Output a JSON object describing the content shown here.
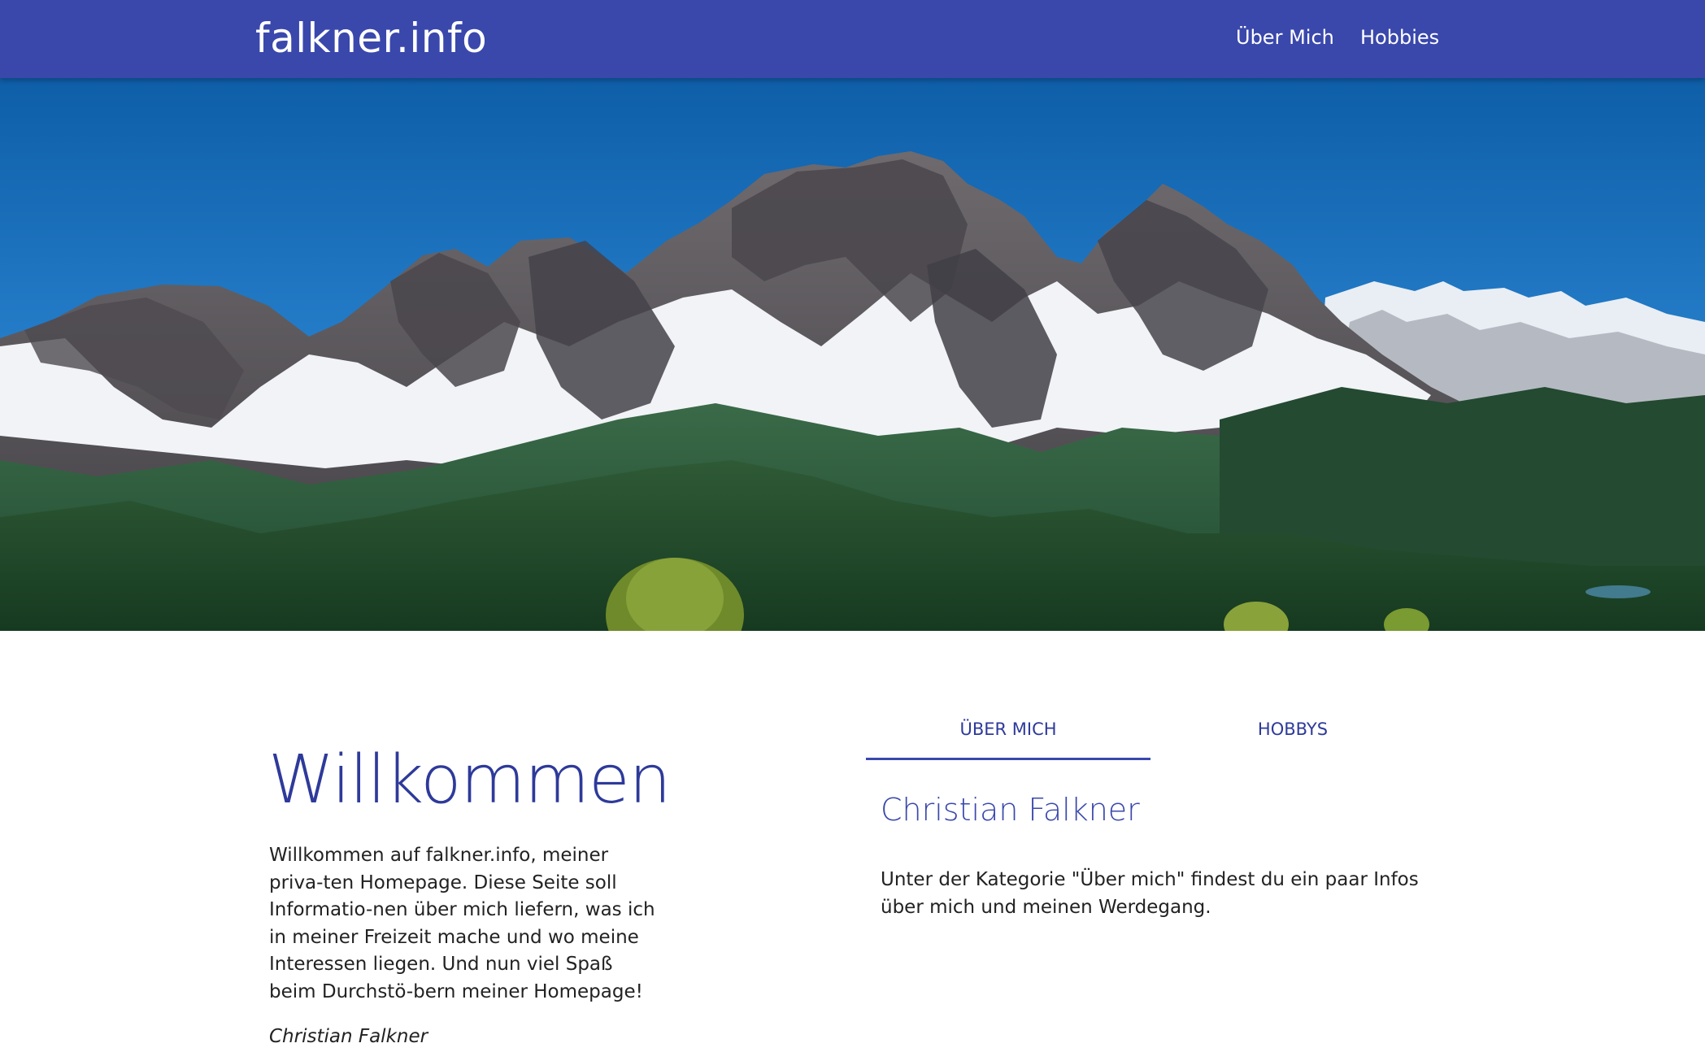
{
  "header": {
    "brand": "falkner.info",
    "nav": [
      {
        "label": "Über Mich"
      },
      {
        "label": "Hobbies"
      }
    ]
  },
  "hero": {
    "image": "mountain-landscape-photo"
  },
  "welcome": {
    "title": "Willkommen",
    "text": "Willkommen auf falkner.info, meiner priva-ten Homepage. Diese Seite soll Informatio-nen über mich liefern, was ich in meiner Freizeit mache und wo meine Interessen liegen. Und nun viel Spaß beim Durchstö-bern meiner Homepage!",
    "signature": "Christian Falkner"
  },
  "tabs": {
    "items": [
      {
        "label": "ÜBER MICH",
        "active": true
      },
      {
        "label": "HOBBYS",
        "active": false
      }
    ],
    "active_content": {
      "heading": "Christian Falkner",
      "text": "Unter der Kategorie \"Über mich\" findest du ein paar Infos über mich und meinen Werdegang."
    }
  },
  "colors": {
    "primary": "#3a48ac",
    "heading": "#2e3a9a",
    "text": "#222222"
  }
}
